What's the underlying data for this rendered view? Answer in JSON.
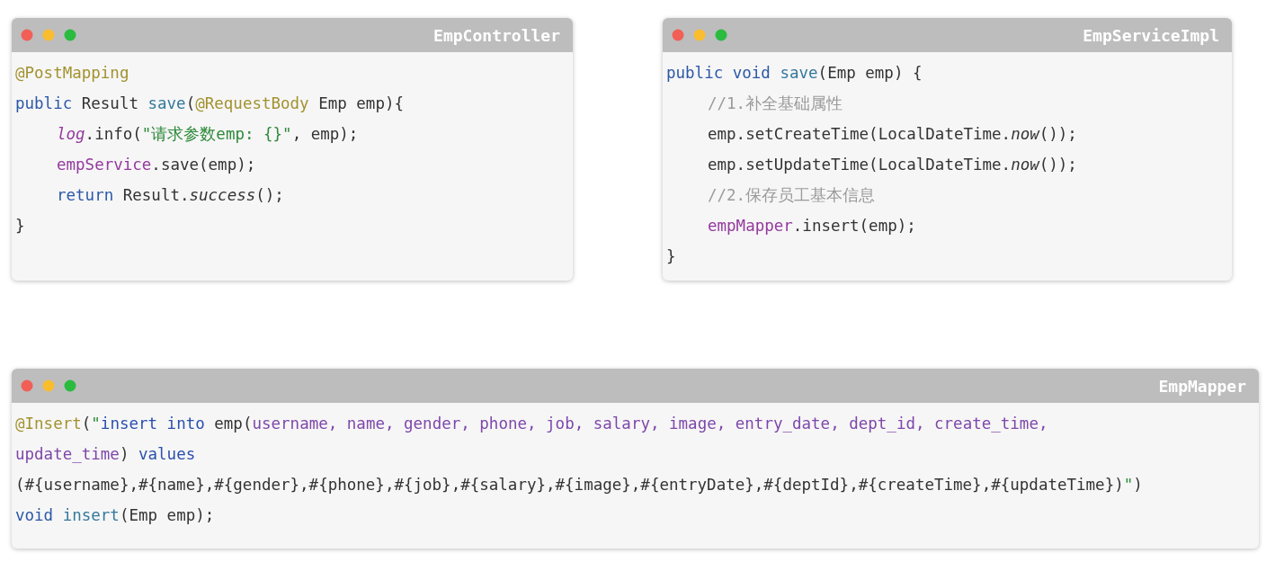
{
  "windows": [
    {
      "title": "EmpController",
      "lines": [
        {
          "indented": false,
          "tokens": [
            {
              "text": "@PostMapping",
              "kind": "annotation"
            }
          ]
        },
        {
          "indented": false,
          "tokens": [
            {
              "text": "public",
              "kind": "keyword"
            },
            {
              "text": " Result ",
              "kind": "plain"
            },
            {
              "text": "save",
              "kind": "method"
            },
            {
              "text": "(",
              "kind": "plain"
            },
            {
              "text": "@RequestBody",
              "kind": "annotation"
            },
            {
              "text": " Emp emp){",
              "kind": "plain"
            }
          ]
        },
        {
          "indented": true,
          "tokens": [
            {
              "text": "log",
              "kind": "fielditalic"
            },
            {
              "text": ".info(",
              "kind": "plain"
            },
            {
              "text": "\"请求参数emp: {}\"",
              "kind": "string"
            },
            {
              "text": ", emp);",
              "kind": "plain"
            }
          ]
        },
        {
          "indented": true,
          "tokens": [
            {
              "text": "empService",
              "kind": "field"
            },
            {
              "text": ".save(emp);",
              "kind": "plain"
            }
          ]
        },
        {
          "indented": true,
          "tokens": [
            {
              "text": "return",
              "kind": "keyword"
            },
            {
              "text": " Result.",
              "kind": "plain"
            },
            {
              "text": "success",
              "kind": "italic"
            },
            {
              "text": "();",
              "kind": "plain"
            }
          ]
        },
        {
          "indented": false,
          "tokens": [
            {
              "text": "}",
              "kind": "plain"
            }
          ]
        }
      ]
    },
    {
      "title": "EmpServiceImpl",
      "lines": [
        {
          "indented": false,
          "tokens": [
            {
              "text": "public void",
              "kind": "keyword"
            },
            {
              "text": " save",
              "kind": "method"
            },
            {
              "text": "(Emp emp) {",
              "kind": "plain"
            }
          ]
        },
        {
          "indented": true,
          "tokens": [
            {
              "text": "//1.补全基础属性",
              "kind": "comment"
            }
          ]
        },
        {
          "indented": true,
          "tokens": [
            {
              "text": "emp.setCreateTime(LocalDateTime.",
              "kind": "plain"
            },
            {
              "text": "now",
              "kind": "italic"
            },
            {
              "text": "());",
              "kind": "plain"
            }
          ]
        },
        {
          "indented": true,
          "tokens": [
            {
              "text": "emp.setUpdateTime(LocalDateTime.",
              "kind": "plain"
            },
            {
              "text": "now",
              "kind": "italic"
            },
            {
              "text": "());",
              "kind": "plain"
            }
          ]
        },
        {
          "indented": true,
          "tokens": [
            {
              "text": "//2.保存员工基本信息",
              "kind": "comment"
            }
          ]
        },
        {
          "indented": true,
          "tokens": [
            {
              "text": "empMapper",
              "kind": "field"
            },
            {
              "text": ".insert(emp);",
              "kind": "plain"
            }
          ]
        },
        {
          "indented": false,
          "tokens": [
            {
              "text": "}",
              "kind": "plain"
            }
          ]
        }
      ]
    },
    {
      "title": "EmpMapper",
      "lines": [
        {
          "indented": false,
          "tokens": [
            {
              "text": "@Insert",
              "kind": "annotation"
            },
            {
              "text": "(",
              "kind": "plain"
            },
            {
              "text": "\"",
              "kind": "string"
            },
            {
              "text": "insert into",
              "kind": "sqlkeyword"
            },
            {
              "text": " emp(",
              "kind": "plain"
            },
            {
              "text": "username, name, gender, phone, job, salary, image, entry_date, dept_id, create_time,",
              "kind": "sqlcolumn"
            }
          ]
        },
        {
          "indented": false,
          "tokens": [
            {
              "text": "update_time",
              "kind": "sqlcolumn"
            },
            {
              "text": ") ",
              "kind": "plain"
            },
            {
              "text": "values",
              "kind": "sqlkeyword"
            }
          ]
        },
        {
          "indented": false,
          "tokens": [
            {
              "text": "(#{username},#{name},#{gender},#{phone},#{job},#{salary},#{image},#{entryDate},#{deptId},#{createTime},#{updateTime})",
              "kind": "plain"
            },
            {
              "text": "\"",
              "kind": "string"
            },
            {
              "text": ")",
              "kind": "plain"
            }
          ]
        },
        {
          "indented": false,
          "tokens": [
            {
              "text": "void",
              "kind": "keyword"
            },
            {
              "text": " insert",
              "kind": "method"
            },
            {
              "text": "(Emp emp);",
              "kind": "plain"
            }
          ]
        }
      ]
    }
  ]
}
